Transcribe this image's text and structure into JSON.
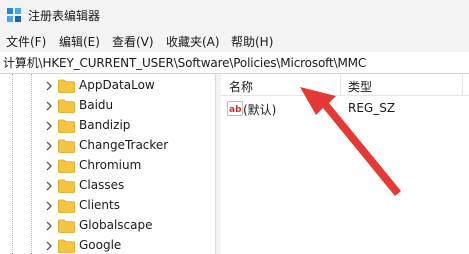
{
  "window": {
    "title": "注册表编辑器",
    "icon": "regedit-icon"
  },
  "menubar": {
    "items": [
      {
        "label": "文件(F)"
      },
      {
        "label": "编辑(E)"
      },
      {
        "label": "查看(V)"
      },
      {
        "label": "收藏夹(A)"
      },
      {
        "label": "帮助(H)"
      }
    ]
  },
  "addressbar": {
    "path": "计算机\\HKEY_CURRENT_USER\\Software\\Policies\\Microsoft\\MMC"
  },
  "tree": {
    "folder_color": "#f5c542",
    "items": [
      {
        "label": "AppDataLow"
      },
      {
        "label": "Baidu"
      },
      {
        "label": "Bandizip"
      },
      {
        "label": "ChangeTracker"
      },
      {
        "label": "Chromium"
      },
      {
        "label": "Classes"
      },
      {
        "label": "Clients"
      },
      {
        "label": "Globalscape"
      },
      {
        "label": "Google"
      }
    ]
  },
  "values_pane": {
    "columns": {
      "name": "名称",
      "type": "类型"
    },
    "rows": [
      {
        "icon": "reg-sz-icon",
        "name": "(默认)",
        "type": "REG_SZ"
      }
    ]
  },
  "annotation": {
    "color": "#e53935",
    "icon": "red-arrow-pointer"
  }
}
